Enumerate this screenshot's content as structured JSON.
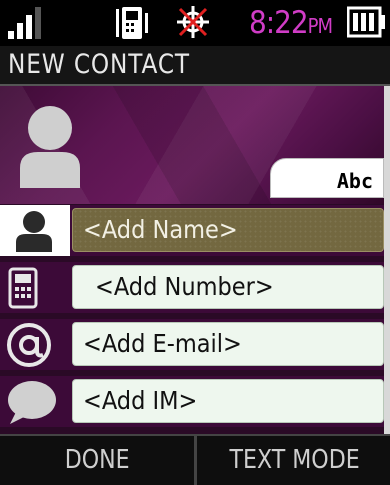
{
  "status_bar": {
    "time": "8:22",
    "ampm": "PM",
    "icons": [
      "signal-strength-icon",
      "vibrate-icon",
      "gps-off-icon",
      "battery-full-icon"
    ]
  },
  "title_bar": {
    "title": "NEW CONTACT"
  },
  "hero": {
    "avatar_icon": "person-silhouette-icon",
    "text_mode_indicator": "Abc"
  },
  "fields": [
    {
      "icon": "person-icon",
      "placeholder": "<Add Name>",
      "selected": true
    },
    {
      "icon": "phone-icon",
      "placeholder": "<Add Number>",
      "selected": false
    },
    {
      "icon": "at-sign-icon",
      "placeholder": "<Add E-mail>",
      "selected": false
    },
    {
      "icon": "speech-bubble-icon",
      "placeholder": "<Add IM>",
      "selected": false
    }
  ],
  "softkeys": {
    "left": "DONE",
    "right": "TEXT MODE"
  },
  "colors": {
    "time": "#d03cc6",
    "selected_field": "#736840",
    "field_background": "#eef7ee",
    "background": "#3c0a38"
  }
}
